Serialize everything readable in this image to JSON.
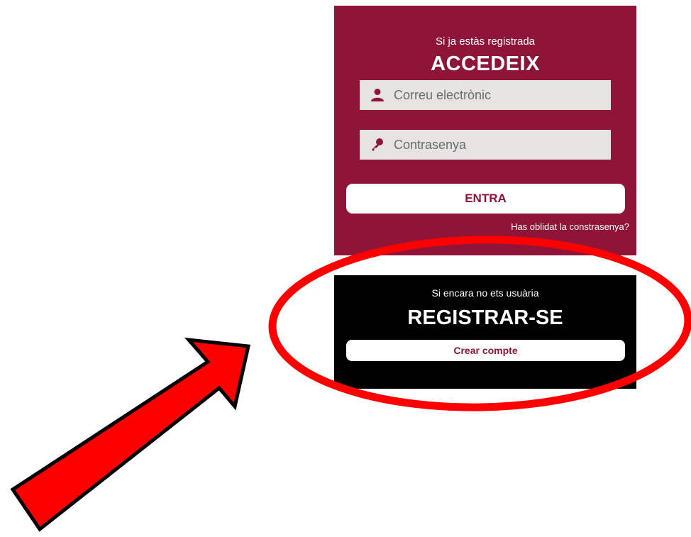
{
  "login": {
    "subtitle": "Si ja estàs registrada",
    "title": "ACCEDEIX",
    "email_placeholder": "Correu electrònic",
    "password_placeholder": "Contrasenya",
    "submit_label": "ENTRA",
    "forgot_label": "Has oblidat la constrasenya?",
    "icons": {
      "email": "user-icon",
      "password": "key-icon"
    }
  },
  "register": {
    "subtitle": "Si encara no ets usuària",
    "title": "REGISTRAR-SE",
    "create_label": "Crear compte"
  },
  "colors": {
    "brand": "#8e1538",
    "register_bg": "#000000",
    "field_bg": "#e6e4e2",
    "annotation_red": "#ff0000"
  }
}
